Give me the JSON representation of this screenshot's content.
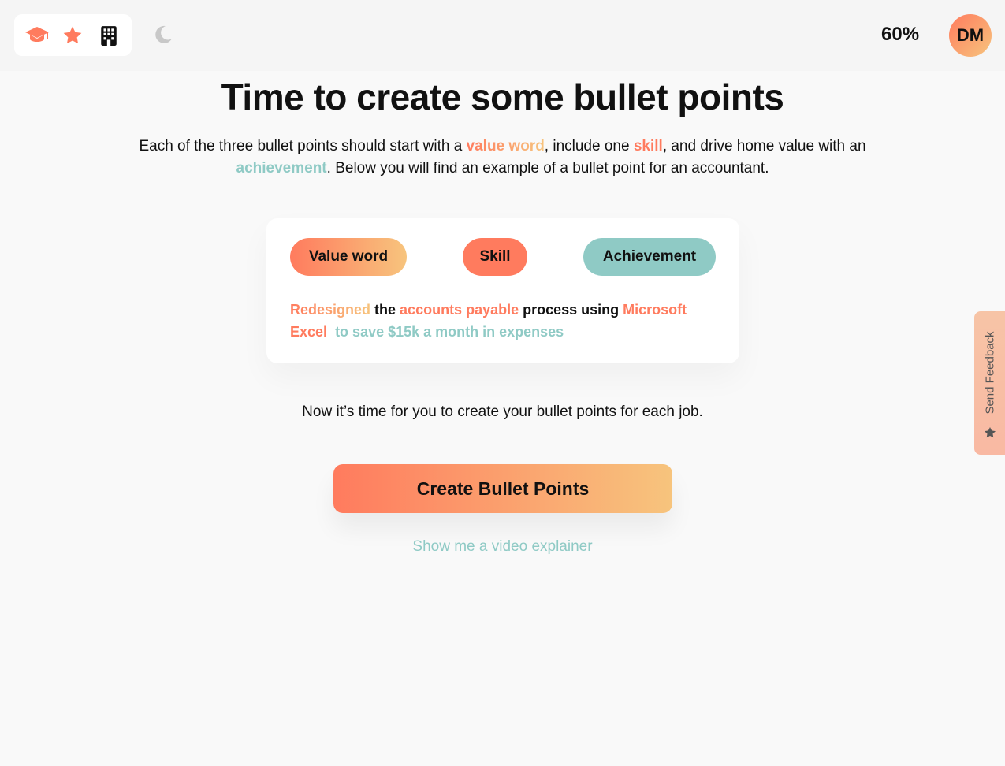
{
  "nav": {
    "icons": [
      "graduation-cap-icon",
      "star-icon",
      "building-icon"
    ],
    "theme_toggle": "moon-icon",
    "progress": "60%",
    "avatar_initials": "DM"
  },
  "page": {
    "title": "Time to create some bullet points",
    "intro": {
      "part1": "Each of the three bullet points should start with a ",
      "value_word": "value word",
      "part2": ", include one ",
      "skill": "skill",
      "part3": ", and drive home value with an ",
      "achievement": "achievement",
      "part4": ". Below you will find an example of a bullet point for an accountant."
    }
  },
  "example_card": {
    "chips": {
      "value_word": "Value word",
      "skill": "Skill",
      "achievement": "Achievement"
    },
    "sentence": {
      "value_word": "Redesigned",
      "the": " the ",
      "skill_a": "accounts payable",
      "process": " process using ",
      "skill_b": "Microsoft Excel",
      "gap": "  ",
      "achievement": "to save $15k a month in expenses"
    }
  },
  "prompt_text": "Now it’s time for you to create your bullet points for each job.",
  "cta_label": "Create Bullet Points",
  "video_link": "Show me a video explainer",
  "feedback_label": "Send Feedback",
  "colors": {
    "accent_coral": "#ff7b5e",
    "accent_peach": "#f7c47d",
    "accent_teal": "#8fcac5"
  }
}
